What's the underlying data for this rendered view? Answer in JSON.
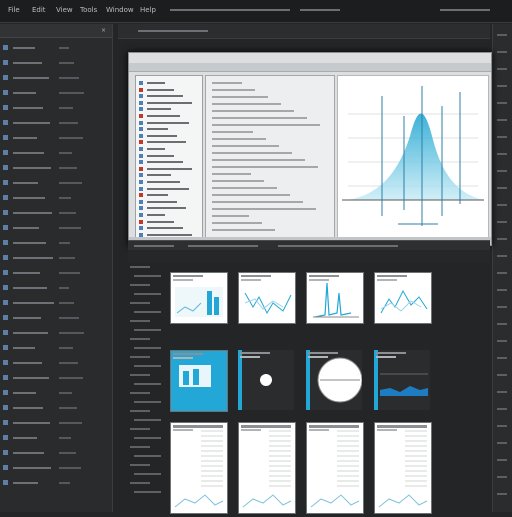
{
  "menubar": {
    "items": [
      "File",
      "Edit",
      "View",
      "Tools",
      "Window",
      "Help"
    ]
  },
  "window": {
    "title": ""
  },
  "left_panel": {
    "title": "",
    "rows": 30
  },
  "toolbar": {
    "label": ""
  },
  "editor": {
    "title": "",
    "status": ""
  },
  "gallery": {
    "label": "",
    "thumbnails": [
      {
        "kind": "bars-teal"
      },
      {
        "kind": "lines-teal"
      },
      {
        "kind": "spikes-teal"
      },
      {
        "kind": "scatter-teal"
      },
      {
        "kind": "solid-blue"
      },
      {
        "kind": "dot-gauge"
      },
      {
        "kind": "circle"
      },
      {
        "kind": "area-blue"
      },
      {
        "kind": "table-doc"
      },
      {
        "kind": "table-doc"
      },
      {
        "kind": "table-doc"
      },
      {
        "kind": "table-doc"
      }
    ]
  },
  "colors": {
    "background": "#242526",
    "panel": "#2a2b2c",
    "accent_teal": "#25a9d3",
    "accent_blue": "#1e7cc2",
    "plot_bg": "#ffffff"
  },
  "icons": [
    "close-icon",
    "folder-icon",
    "file-icon",
    "chart-icon"
  ]
}
